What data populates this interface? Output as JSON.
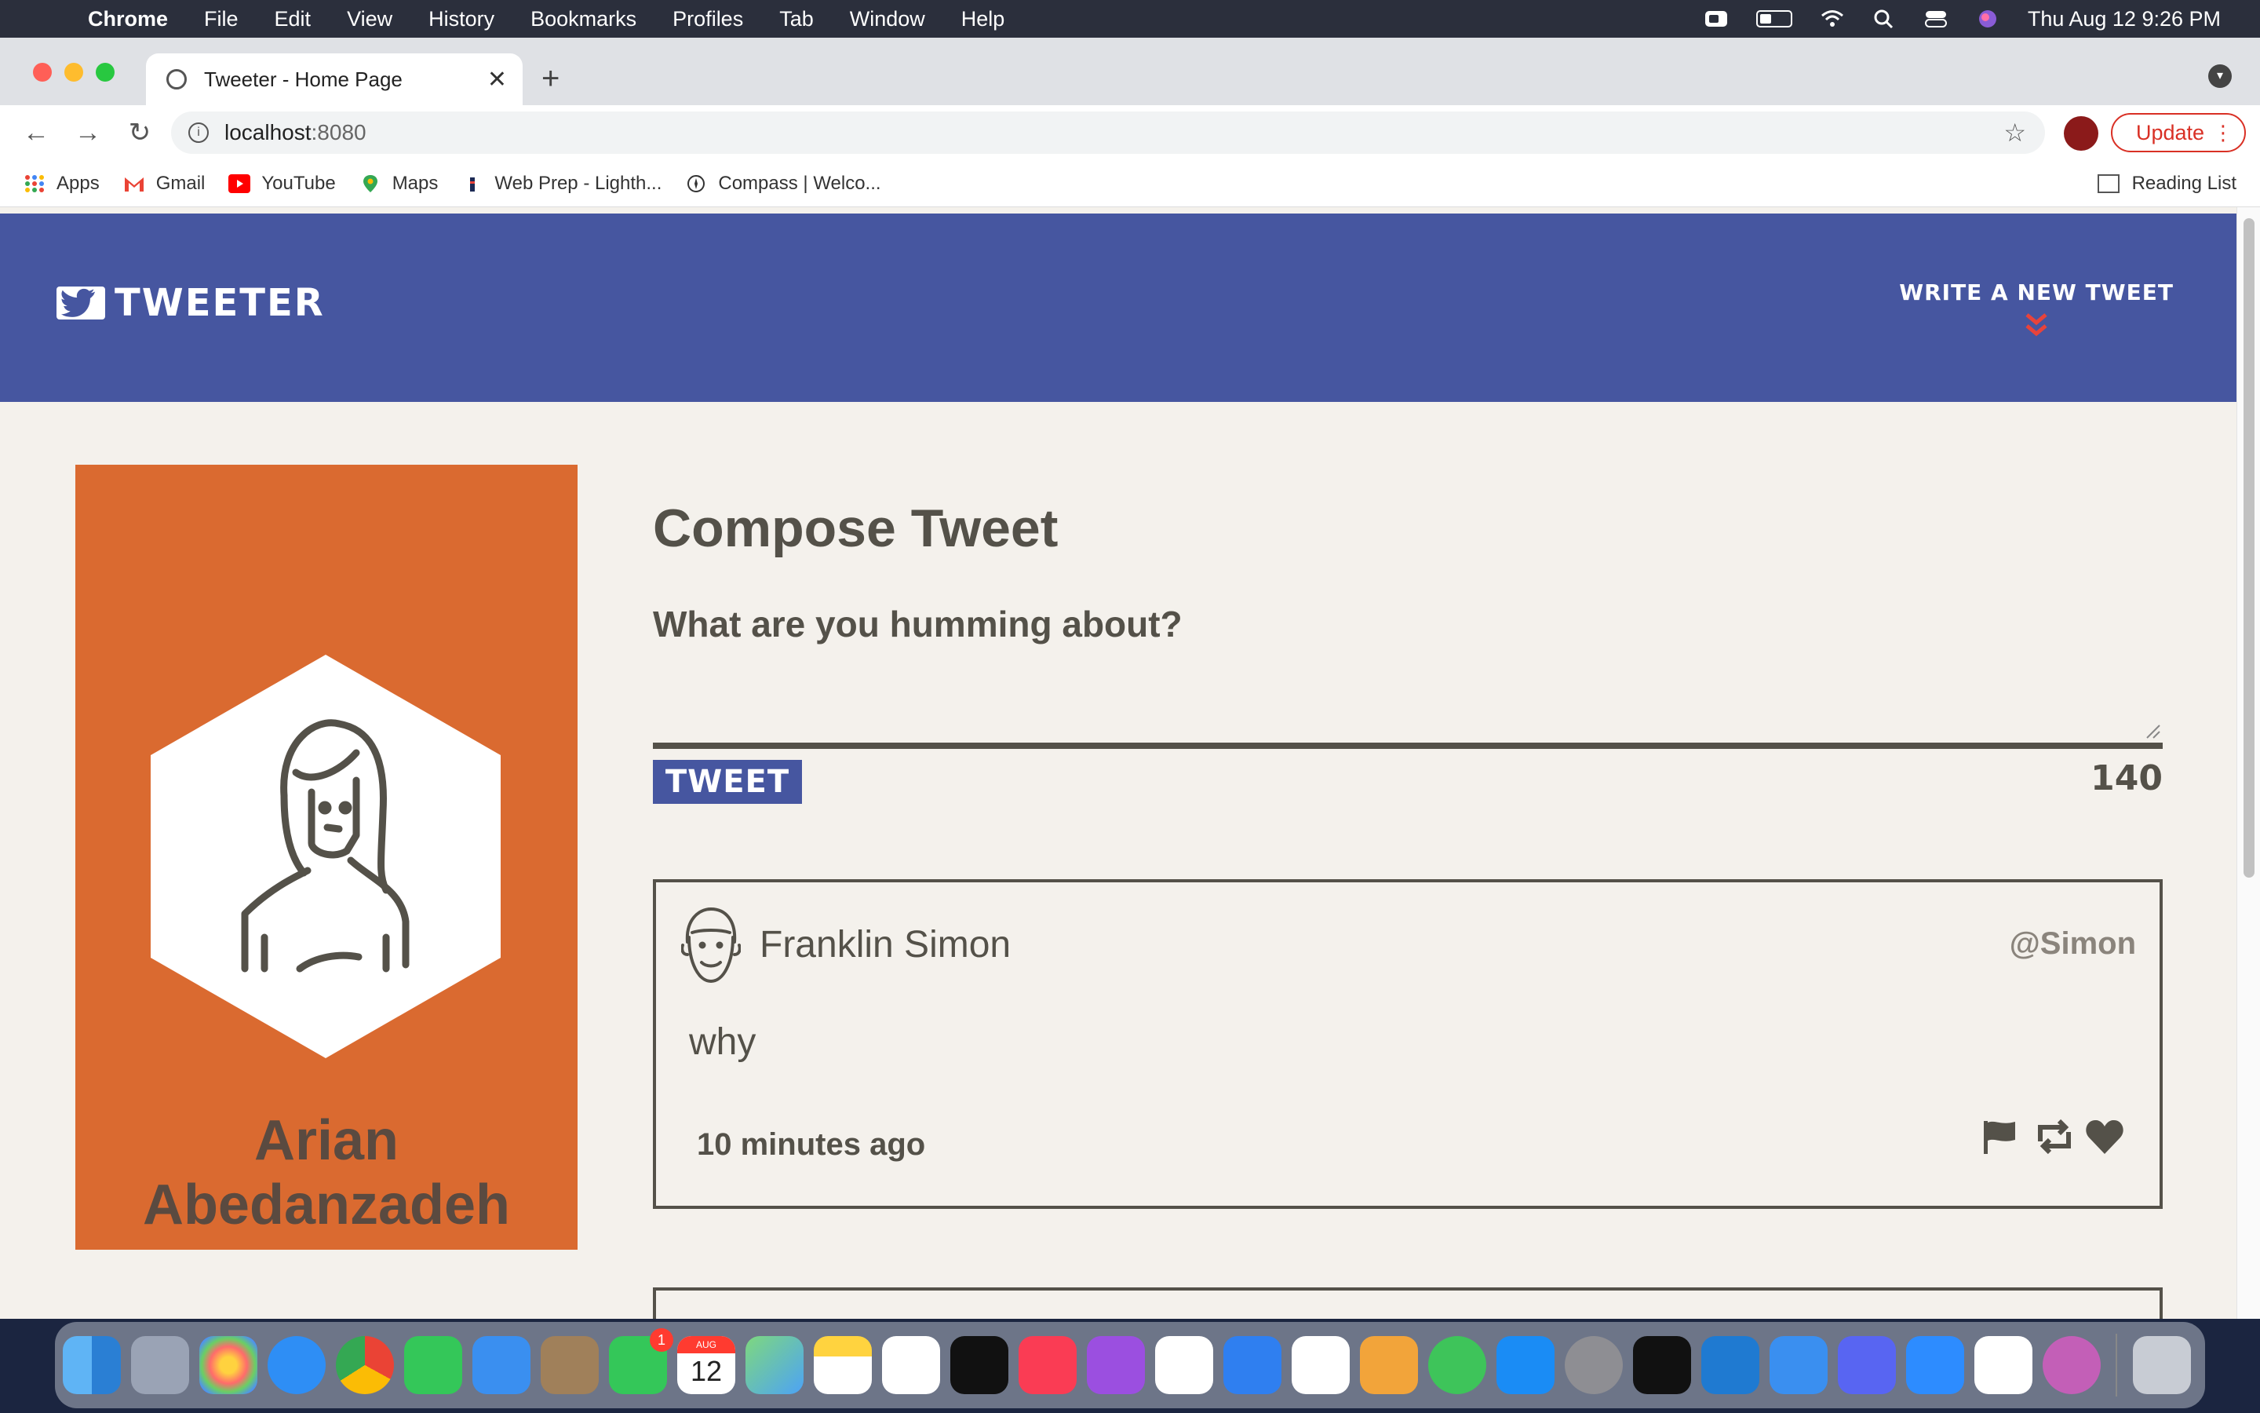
{
  "menubar": {
    "app_name": "Chrome",
    "items": [
      "File",
      "Edit",
      "View",
      "History",
      "Bookmarks",
      "Profiles",
      "Tab",
      "Window",
      "Help"
    ],
    "datetime": "Thu Aug 12  9:26 PM"
  },
  "browser": {
    "tab_title": "Tweeter - Home Page",
    "url_host": "localhost",
    "url_port": ":8080",
    "update_label": "Update"
  },
  "bookmarks": {
    "items": [
      {
        "label": "Apps",
        "icon": "apps-grid-icon"
      },
      {
        "label": "Gmail",
        "icon": "gmail-icon"
      },
      {
        "label": "YouTube",
        "icon": "youtube-icon"
      },
      {
        "label": "Maps",
        "icon": "maps-icon"
      },
      {
        "label": "Web Prep - Lighth...",
        "icon": "lighthouse-icon"
      },
      {
        "label": "Compass | Welco...",
        "icon": "compass-icon"
      }
    ],
    "reading_list": "Reading List"
  },
  "site": {
    "brand": "TWEETER",
    "write_new": "WRITE A NEW TWEET",
    "chevron": "»"
  },
  "profile": {
    "name": "Arian Abedanzadeh"
  },
  "compose": {
    "title": "Compose Tweet",
    "prompt": "What are you humming about?",
    "button": "TWEET",
    "counter": "140"
  },
  "tweets": [
    {
      "author": "Franklin Simon",
      "handle": "@Simon",
      "content": "why",
      "time": "10 minutes ago"
    }
  ],
  "colors": {
    "nav_bg": "#4656a0",
    "profile_bg": "#da6a30",
    "page_bg": "#f4f1ec",
    "text": "#545149",
    "accent_red": "#e8433b"
  },
  "dock": {
    "facetime_badge": "1",
    "calendar_month": "AUG",
    "calendar_day": "12"
  }
}
